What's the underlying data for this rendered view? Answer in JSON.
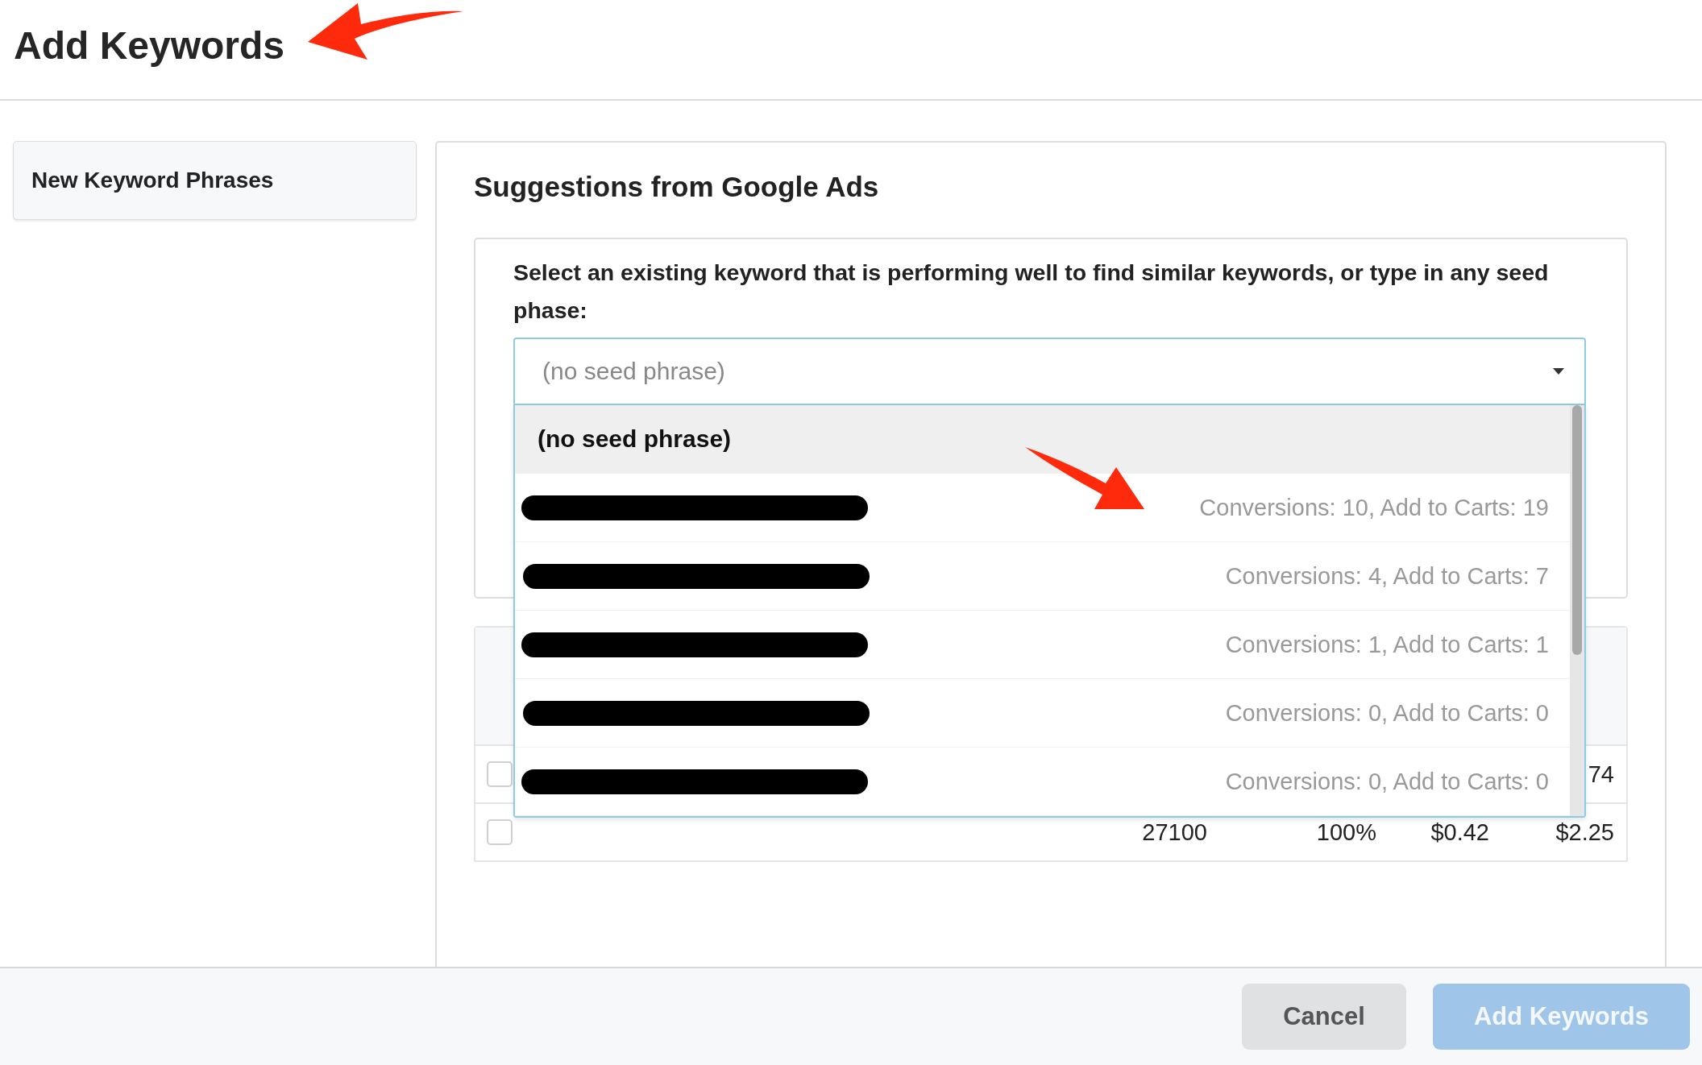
{
  "page": {
    "title": "Add Keywords"
  },
  "sidebar": {
    "items": [
      {
        "label": "New Keyword Phrases"
      }
    ]
  },
  "suggestions": {
    "title": "Suggestions from Google Ads",
    "prompt": "Select an existing keyword that is performing well to find similar keywords, or type in any seed phase:",
    "seed_field": {
      "placeholder": "(no seed phrase)"
    },
    "dropdown": {
      "expanded": true,
      "options": [
        {
          "kind": "none",
          "label": "(no seed phrase)",
          "selected": true
        },
        {
          "kind": "keyword",
          "stats": "Conversions: 10, Add to Carts: 19",
          "selected": false
        },
        {
          "kind": "keyword",
          "stats": "Conversions: 4, Add to Carts: 7",
          "selected": false
        },
        {
          "kind": "keyword",
          "stats": "Conversions: 1, Add to Carts: 1",
          "selected": false
        },
        {
          "kind": "keyword",
          "stats": "Conversions: 0, Add to Carts: 0",
          "selected": false
        },
        {
          "kind": "keyword",
          "stats": "Conversions: 0, Add to Carts: 0",
          "selected": false
        }
      ]
    }
  },
  "table": {
    "rows": [
      {
        "checked": false,
        "values": [
          "74"
        ]
      },
      {
        "checked": false,
        "values": [
          "27100",
          "100%",
          "$0.42",
          "$2.25"
        ]
      }
    ]
  },
  "footer": {
    "buttons": [
      {
        "label": "Cancel",
        "kind": "secondary",
        "disabled": false
      },
      {
        "label": "Add Keywords",
        "kind": "primary",
        "disabled": true
      }
    ]
  },
  "annotations": [
    {
      "kind": "arrow"
    },
    {
      "kind": "arrow"
    }
  ]
}
